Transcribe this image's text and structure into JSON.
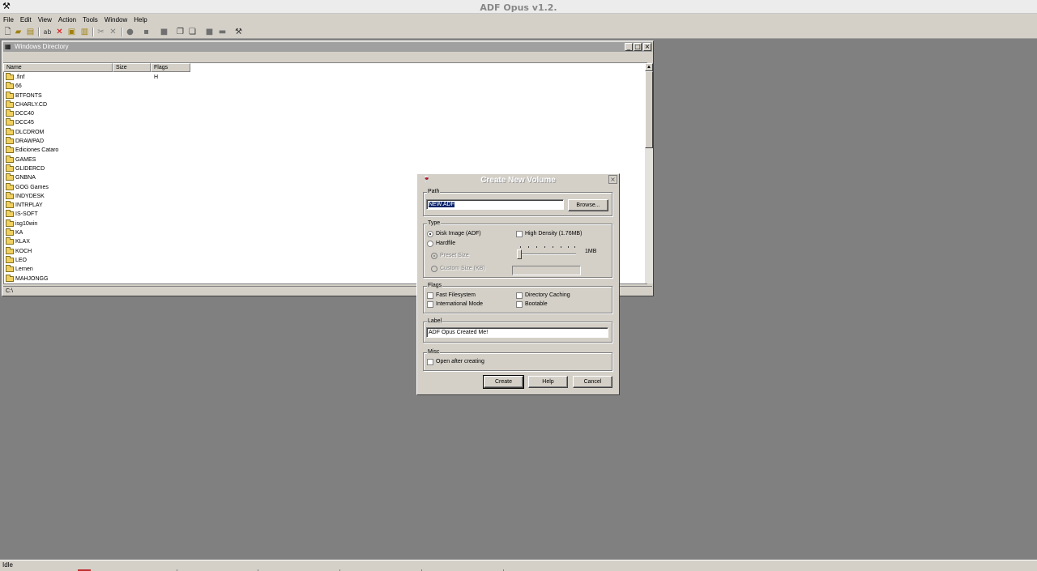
{
  "app": {
    "title": "ADF Opus v1.2."
  },
  "menu": [
    "File",
    "Edit",
    "View",
    "Action",
    "Tools",
    "Window",
    "Help"
  ],
  "directory_window": {
    "title": "Windows Directory",
    "columns": {
      "name": "Name",
      "size": "Size",
      "flags": "Flags"
    },
    "rows": [
      {
        "name": ".finf",
        "flags": "H"
      },
      {
        "name": "66",
        "flags": ""
      },
      {
        "name": "BTFONTS",
        "flags": ""
      },
      {
        "name": "CHARLY.CD",
        "flags": ""
      },
      {
        "name": "DCC40",
        "flags": ""
      },
      {
        "name": "DCC45",
        "flags": ""
      },
      {
        "name": "DLCDROM",
        "flags": ""
      },
      {
        "name": "DRAWPAD",
        "flags": ""
      },
      {
        "name": "Ediciones Cataro",
        "flags": ""
      },
      {
        "name": "GAMES",
        "flags": ""
      },
      {
        "name": "GLIDERCD",
        "flags": ""
      },
      {
        "name": "GNBNA",
        "flags": ""
      },
      {
        "name": "GOG Games",
        "flags": ""
      },
      {
        "name": "INDYDESK",
        "flags": ""
      },
      {
        "name": "INTRPLAY",
        "flags": ""
      },
      {
        "name": "IS-SOFT",
        "flags": ""
      },
      {
        "name": "isg10win",
        "flags": ""
      },
      {
        "name": "KA",
        "flags": ""
      },
      {
        "name": "KLAX",
        "flags": ""
      },
      {
        "name": "KOCH",
        "flags": ""
      },
      {
        "name": "LEO",
        "flags": ""
      },
      {
        "name": "Lernen",
        "flags": ""
      },
      {
        "name": "MAHJONGG",
        "flags": ""
      }
    ],
    "status_path": "C:\\"
  },
  "dialog": {
    "title": "Create New Volume",
    "path_group": "Path",
    "path_value": "NEW.ADF",
    "browse_label": "Browse...",
    "type_group": "Type",
    "disk_image_label": "Disk Image (ADF)",
    "hardfile_label": "Hardfile",
    "high_density_label": "High Density (1.76MB)",
    "preset_size_label": "Preset Size",
    "custom_size_label": "Custom Size (KB)",
    "size_readout": "1MB",
    "flags_group": "Flags",
    "fast_fs_label": "Fast Filesystem",
    "intl_mode_label": "International Mode",
    "dir_caching_label": "Directory Caching",
    "bootable_label": "Bootable",
    "label_group": "Label",
    "label_value": "ADF Opus Created Me!",
    "misc_group": "Misc",
    "open_after_label": "Open after creating",
    "create_label": "Create",
    "help_label": "Help",
    "cancel_label": "Cancel"
  },
  "status": {
    "text": "Idle"
  }
}
